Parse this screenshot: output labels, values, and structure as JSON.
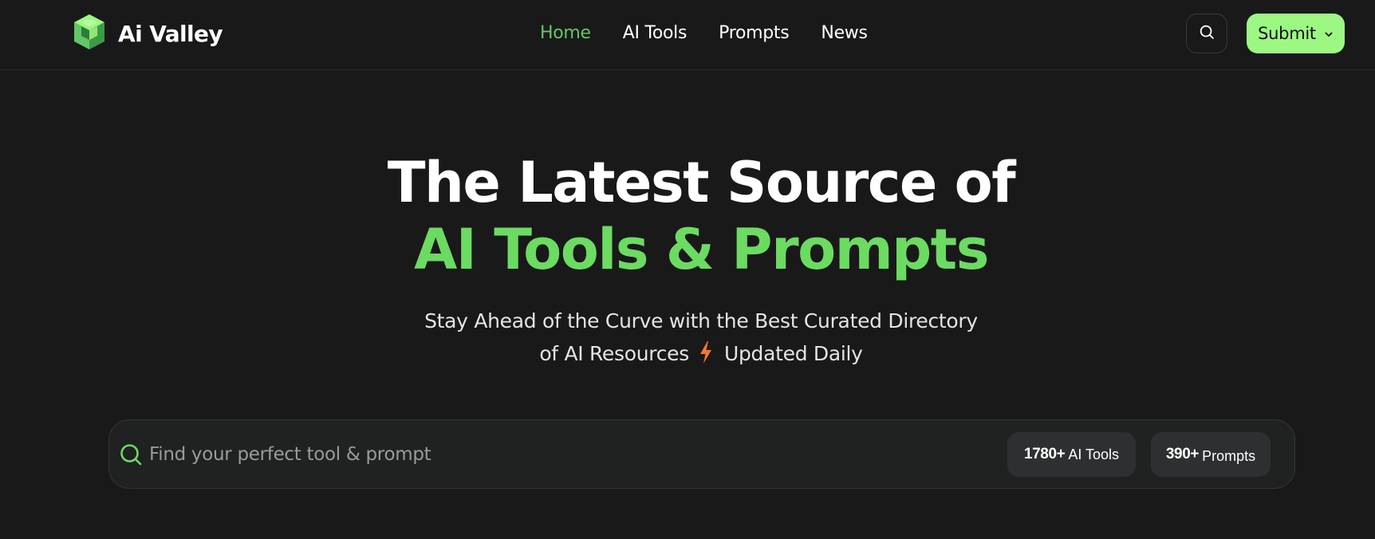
{
  "brand": {
    "name": "Ai Valley",
    "colors": {
      "logo_light": "#9cf883",
      "logo_mid": "#62c766",
      "logo_dark": "#2f7a3a"
    }
  },
  "nav": {
    "links": [
      {
        "label": "Home",
        "active": true
      },
      {
        "label": "AI Tools",
        "active": false
      },
      {
        "label": "Prompts",
        "active": false
      },
      {
        "label": "News",
        "active": false
      }
    ],
    "search_button_icon": "search-icon",
    "submit": {
      "label": "Submit",
      "icon": "chevron-down-icon"
    }
  },
  "hero": {
    "title_line1": "The Latest Source of",
    "title_line2": "AI Tools & Prompts",
    "subtitle_line1": "Stay Ahead of the Curve with the Best Curated Directory",
    "subtitle_line2_a": "of AI Resources",
    "subtitle_icon": "lightning-icon",
    "subtitle_line2_b": "Updated Daily"
  },
  "search": {
    "placeholder": "Find your perfect tool & prompt",
    "value": "",
    "stats": [
      {
        "count": "1780+",
        "label": "AI Tools"
      },
      {
        "count": "390+",
        "label": "Prompts"
      }
    ]
  },
  "colors": {
    "background": "#191919",
    "accent_green": "#6cdb62",
    "nav_active": "#62c766",
    "submit_bg": "#9cf883",
    "bolt_orange": "#f5772f"
  }
}
